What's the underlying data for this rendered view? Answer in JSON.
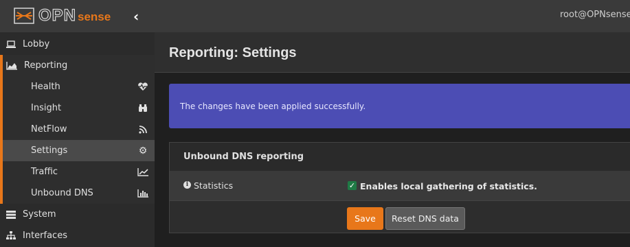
{
  "header": {
    "logo_text": "OPN",
    "logo_suffix": "sense",
    "user": "root@OPNsense.l"
  },
  "sidebar": {
    "items": [
      {
        "label": "Lobby",
        "icon": "laptop-icon"
      },
      {
        "label": "Reporting",
        "icon": "area-chart-icon"
      },
      {
        "label": "System",
        "icon": "server-icon"
      },
      {
        "label": "Interfaces",
        "icon": "sitemap-icon"
      }
    ],
    "sub_items": [
      {
        "label": "Health",
        "icon": "heartbeat-icon"
      },
      {
        "label": "Insight",
        "icon": "binoculars-icon"
      },
      {
        "label": "NetFlow",
        "icon": "rss-icon"
      },
      {
        "label": "Settings",
        "icon": "gear-icon"
      },
      {
        "label": "Traffic",
        "icon": "line-chart-icon"
      },
      {
        "label": "Unbound DNS",
        "icon": "bar-chart-icon"
      }
    ]
  },
  "page": {
    "title": "Reporting: Settings",
    "alert": "The changes have been applied successfully.",
    "panel_title": "Unbound DNS reporting",
    "row_label": "Statistics",
    "checkbox_label": "Enables local gathering of statistics.",
    "checkbox_checked": true,
    "save_label": "Save",
    "reset_label": "Reset DNS data"
  },
  "colors": {
    "accent": "#e8771a",
    "alert_bg": "#4c4db4",
    "checkbox": "#1f7a45"
  }
}
